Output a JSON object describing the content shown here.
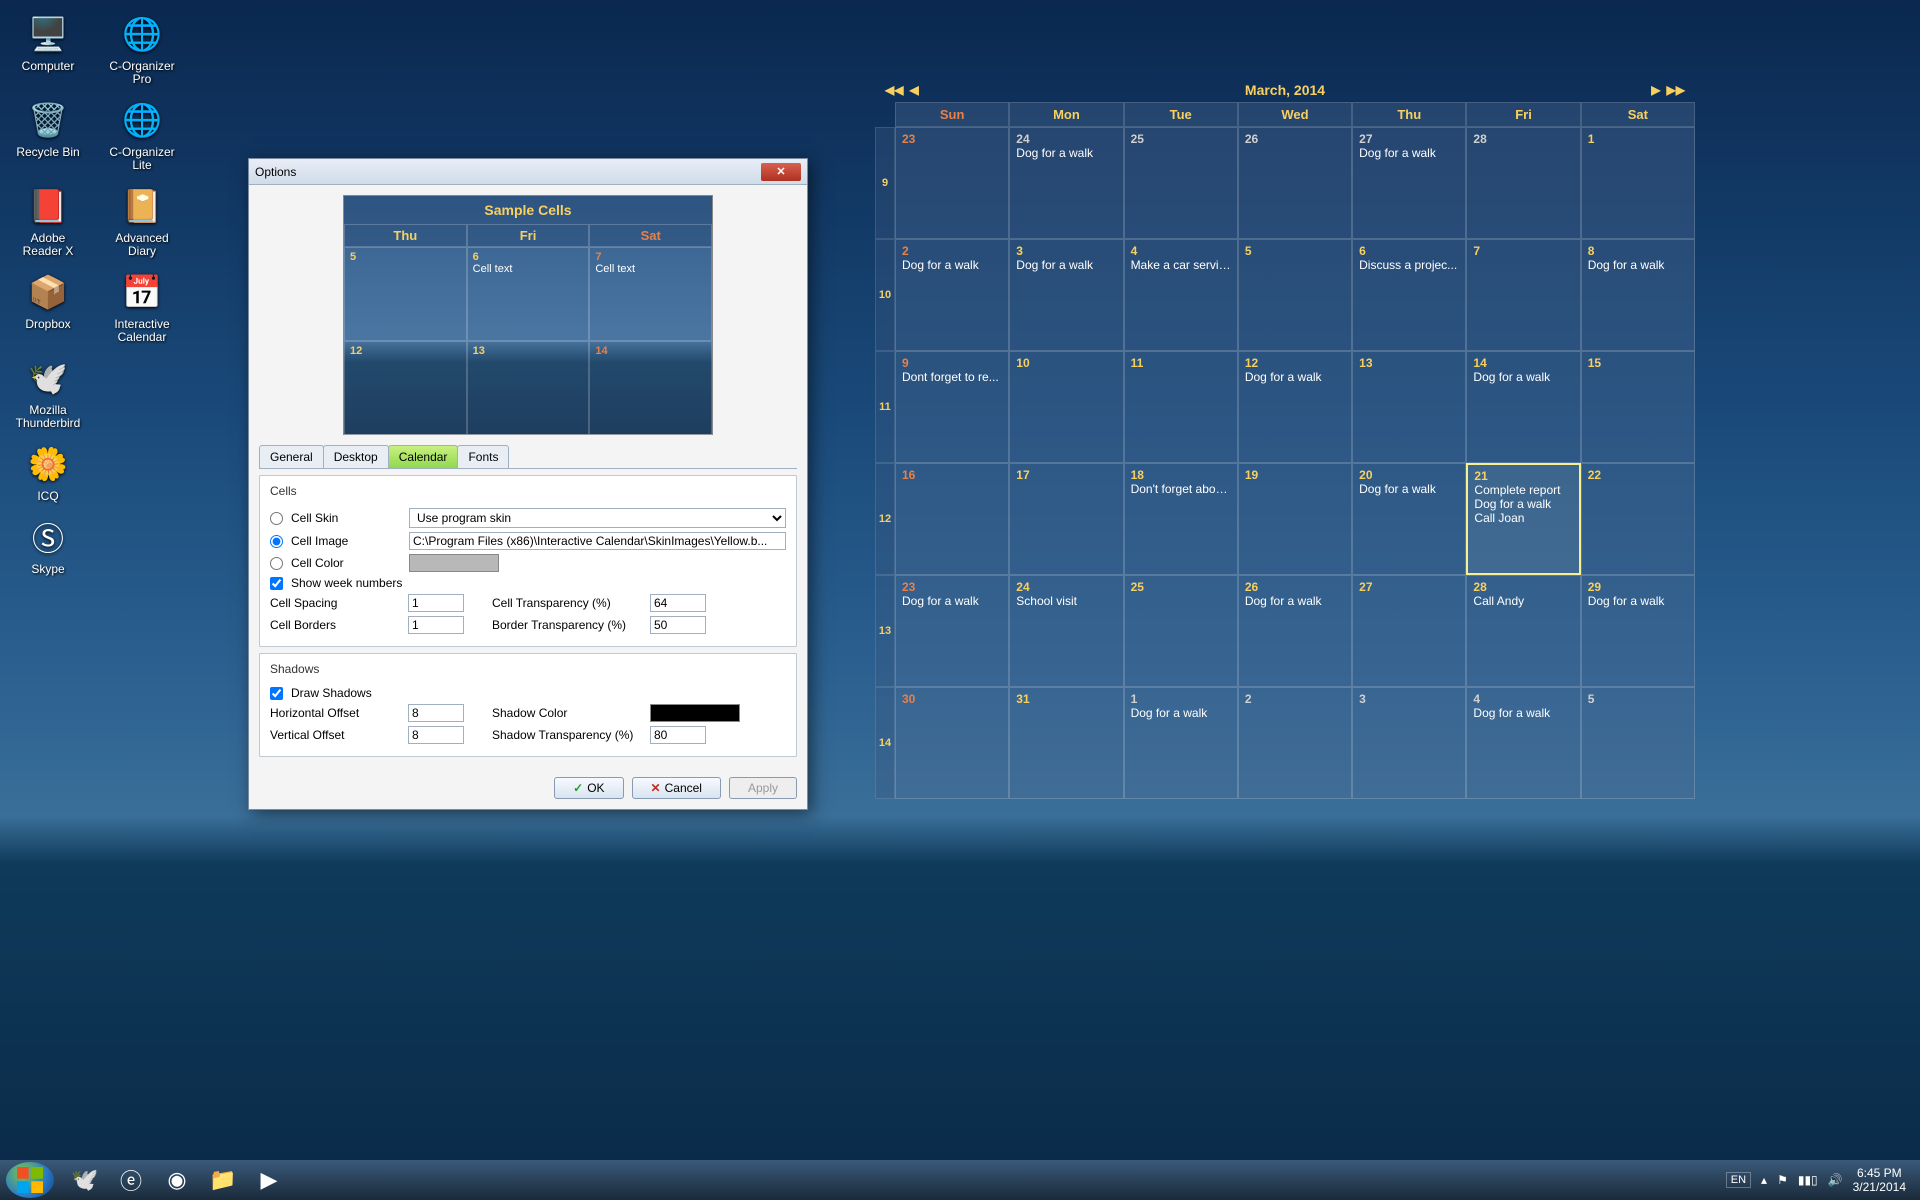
{
  "desktop": {
    "icons": [
      [
        {
          "label": "Computer",
          "glyph": "🖥️"
        },
        {
          "label": "C-Organizer Pro",
          "glyph": "🌐"
        }
      ],
      [
        {
          "label": "Recycle Bin",
          "glyph": "🗑️"
        },
        {
          "label": "C-Organizer Lite",
          "glyph": "🌐"
        }
      ],
      [
        {
          "label": "Adobe Reader X",
          "glyph": "📕"
        },
        {
          "label": "Advanced Diary",
          "glyph": "📔"
        }
      ],
      [
        {
          "label": "Dropbox",
          "glyph": "📦"
        },
        {
          "label": "Interactive Calendar",
          "glyph": "📅"
        }
      ],
      [
        {
          "label": "Mozilla Thunderbird",
          "glyph": "🕊️"
        }
      ],
      [
        {
          "label": "ICQ",
          "glyph": "🌼"
        }
      ],
      [
        {
          "label": "Skype",
          "glyph": "Ⓢ"
        }
      ]
    ]
  },
  "calendar": {
    "title": "March, 2014",
    "dayHeaders": [
      "Sun",
      "Mon",
      "Tue",
      "Wed",
      "Thu",
      "Fri",
      "Sat"
    ],
    "weekNumbers": [
      "9",
      "10",
      "11",
      "12",
      "13",
      "14"
    ],
    "weeks": [
      [
        {
          "day": "23",
          "other": true
        },
        {
          "day": "24",
          "other": true,
          "events": [
            "Dog for a walk"
          ]
        },
        {
          "day": "25",
          "other": true
        },
        {
          "day": "26",
          "other": true
        },
        {
          "day": "27",
          "other": true,
          "events": [
            "Dog for a walk"
          ]
        },
        {
          "day": "28",
          "other": true
        },
        {
          "day": "1"
        }
      ],
      [
        {
          "day": "2",
          "events": [
            "Dog for a walk"
          ]
        },
        {
          "day": "3",
          "events": [
            "Dog for a walk"
          ]
        },
        {
          "day": "4",
          "events": [
            "Make a car service"
          ]
        },
        {
          "day": "5"
        },
        {
          "day": "6",
          "events": [
            "Discuss a projec..."
          ]
        },
        {
          "day": "7"
        },
        {
          "day": "8",
          "events": [
            "Dog for a walk"
          ]
        }
      ],
      [
        {
          "day": "9",
          "events": [
            "Dont forget to re..."
          ]
        },
        {
          "day": "10"
        },
        {
          "day": "11"
        },
        {
          "day": "12",
          "events": [
            "Dog for a walk"
          ]
        },
        {
          "day": "13"
        },
        {
          "day": "14",
          "events": [
            "Dog for a walk"
          ]
        },
        {
          "day": "15"
        }
      ],
      [
        {
          "day": "16"
        },
        {
          "day": "17"
        },
        {
          "day": "18",
          "events": [
            "Don't forget abou..."
          ]
        },
        {
          "day": "19"
        },
        {
          "day": "20",
          "events": [
            "Dog for a walk"
          ]
        },
        {
          "day": "21",
          "today": true,
          "events": [
            "Complete report",
            "Dog for a walk",
            "Call Joan"
          ]
        },
        {
          "day": "22"
        }
      ],
      [
        {
          "day": "23",
          "events": [
            "Dog for a walk"
          ]
        },
        {
          "day": "24",
          "events": [
            "School visit"
          ]
        },
        {
          "day": "25"
        },
        {
          "day": "26",
          "events": [
            "Dog for a walk"
          ]
        },
        {
          "day": "27"
        },
        {
          "day": "28",
          "events": [
            "Call Andy"
          ]
        },
        {
          "day": "29",
          "events": [
            "Dog for a walk"
          ]
        }
      ],
      [
        {
          "day": "30"
        },
        {
          "day": "31"
        },
        {
          "day": "1",
          "other": true,
          "events": [
            "Dog for a walk"
          ]
        },
        {
          "day": "2",
          "other": true
        },
        {
          "day": "3",
          "other": true
        },
        {
          "day": "4",
          "other": true,
          "events": [
            "Dog for a walk"
          ]
        },
        {
          "day": "5",
          "other": true
        }
      ]
    ]
  },
  "dialog": {
    "title": "Options",
    "preview": {
      "title": "Sample Cells",
      "headers": [
        "Thu",
        "Fri",
        "Sat"
      ],
      "cells": [
        [
          {
            "d": "5",
            "t": ""
          },
          {
            "d": "6",
            "t": "Cell text"
          },
          {
            "d": "7",
            "t": "Cell text"
          }
        ],
        [
          {
            "d": "12",
            "t": ""
          },
          {
            "d": "13",
            "t": ""
          },
          {
            "d": "14",
            "t": ""
          }
        ]
      ]
    },
    "tabs": [
      "General",
      "Desktop",
      "Calendar",
      "Fonts"
    ],
    "activeTab": "Calendar",
    "cells": {
      "groupTitle": "Cells",
      "cellSkin": {
        "label": "Cell Skin",
        "value": "Use program skin",
        "selected": false
      },
      "cellImage": {
        "label": "Cell Image",
        "value": "C:\\Program Files (x86)\\Interactive Calendar\\SkinImages\\Yellow.b...",
        "selected": true
      },
      "cellColor": {
        "label": "Cell Color",
        "selected": false
      },
      "showWeek": {
        "label": "Show week numbers",
        "checked": true
      },
      "cellSpacing": {
        "label": "Cell Spacing",
        "value": "1"
      },
      "cellBorders": {
        "label": "Cell Borders",
        "value": "1"
      },
      "cellTransparency": {
        "label": "Cell Transparency (%)",
        "value": "64"
      },
      "borderTransparency": {
        "label": "Border Transparency (%)",
        "value": "50"
      }
    },
    "shadows": {
      "groupTitle": "Shadows",
      "draw": {
        "label": "Draw Shadows",
        "checked": true
      },
      "hoffset": {
        "label": "Horizontal Offset",
        "value": "8"
      },
      "voffset": {
        "label": "Vertical Offset",
        "value": "8"
      },
      "shadowColor": {
        "label": "Shadow Color"
      },
      "shadowTransparency": {
        "label": "Shadow Transparency (%)",
        "value": "80"
      }
    },
    "buttons": {
      "ok": "OK",
      "cancel": "Cancel",
      "apply": "Apply"
    }
  },
  "taskbar": {
    "pinned": [
      {
        "name": "thunderbird",
        "glyph": "🕊️"
      },
      {
        "name": "ie",
        "glyph": "ⓔ"
      },
      {
        "name": "chrome",
        "glyph": "◉"
      },
      {
        "name": "explorer",
        "glyph": "📁"
      },
      {
        "name": "wmplayer",
        "glyph": "▶"
      }
    ],
    "tray": {
      "lang": "EN",
      "time": "6:45 PM",
      "date": "3/21/2014"
    }
  }
}
